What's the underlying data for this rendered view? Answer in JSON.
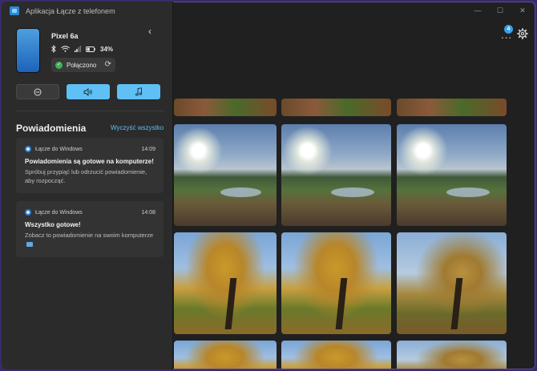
{
  "window": {
    "title": "Aplikacja Łącze z telefonem",
    "controls": [
      "—",
      "☐",
      "✕"
    ]
  },
  "topbar": {
    "more_label": "...",
    "badge_count": "4",
    "settings_icon": "gear-icon"
  },
  "device": {
    "name": "Pixel 6a",
    "battery": "34%",
    "connection_label": "Połączono",
    "collapse_icon": "chevron-left-icon"
  },
  "quick_actions": [
    {
      "name": "do-not-disturb",
      "icon": "minus-circle-icon",
      "active": false
    },
    {
      "name": "volume",
      "icon": "speaker-icon",
      "active": true
    },
    {
      "name": "media",
      "icon": "music-note-icon",
      "active": true
    }
  ],
  "notifications": {
    "title": "Powiadomienia",
    "clear_all": "Wyczyść wszystko",
    "items": [
      {
        "app": "Łącze do Windows",
        "time": "14:09",
        "headline": "Powiadomienia są gotowe na komputerze!",
        "body": "Spróbuj przypiąć lub odrzucić powiadomienie, aby rozpocząć."
      },
      {
        "app": "Łącze do Windows",
        "time": "14:08",
        "headline": "Wszystko gotowe!",
        "body": "Zobacz to powiadomienie na swoim komputerze"
      }
    ]
  },
  "colors": {
    "accent": "#5fc0f5",
    "connected": "#3cb454",
    "panel_bg": "#2b2b2b",
    "card_bg": "#333333"
  }
}
